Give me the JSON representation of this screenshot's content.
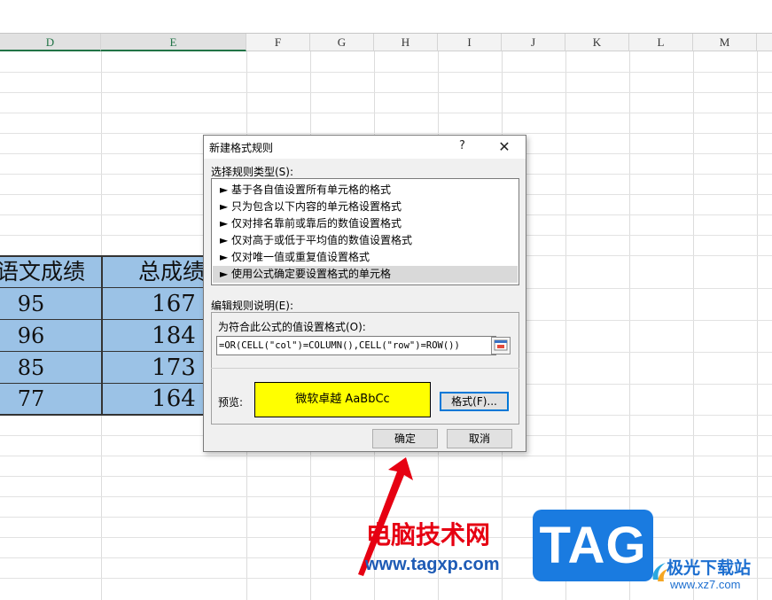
{
  "sheet": {
    "columns": [
      "D",
      "E",
      "F",
      "G",
      "H",
      "I",
      "J",
      "K",
      "L",
      "M"
    ],
    "selected_columns": [
      "D",
      "E"
    ],
    "header_row": {
      "d": "语文成绩",
      "e": "总成绩"
    },
    "rows": [
      {
        "d": "95",
        "e": "167"
      },
      {
        "d": "96",
        "e": "184"
      },
      {
        "d": "85",
        "e": "173"
      },
      {
        "d": "77",
        "e": "164"
      }
    ],
    "highlight_color": "#9bc2e6"
  },
  "dialog": {
    "title": "新建格式规则",
    "help": "?",
    "close": "✕",
    "rule_type_label": "选择规则类型(S):",
    "rule_types": [
      "► 基于各自值设置所有单元格的格式",
      "► 只为包含以下内容的单元格设置格式",
      "► 仅对排名靠前或靠后的数值设置格式",
      "► 仅对高于或低于平均值的数值设置格式",
      "► 仅对唯一值或重复值设置格式",
      "► 使用公式确定要设置格式的单元格"
    ],
    "selected_rule_index": 5,
    "edit_label": "编辑规则说明(E):",
    "formula_label": "为符合此公式的值设置格式(O):",
    "formula_value": "=OR(CELL(\"col\")=COLUMN(),CELL(\"row\")=ROW())",
    "preview_label": "预览:",
    "preview_text": "微软卓越  AaBbCc",
    "preview_color": "#ffff00",
    "format_button": "格式(F)...",
    "ok_button": "确定",
    "cancel_button": "取消"
  },
  "watermark": {
    "site_name": "电脑技术网",
    "site_url": "www.tagxp.com",
    "badge": "TAG",
    "brand2": "极光下载站",
    "brand2_url": "www.xz7.com"
  }
}
